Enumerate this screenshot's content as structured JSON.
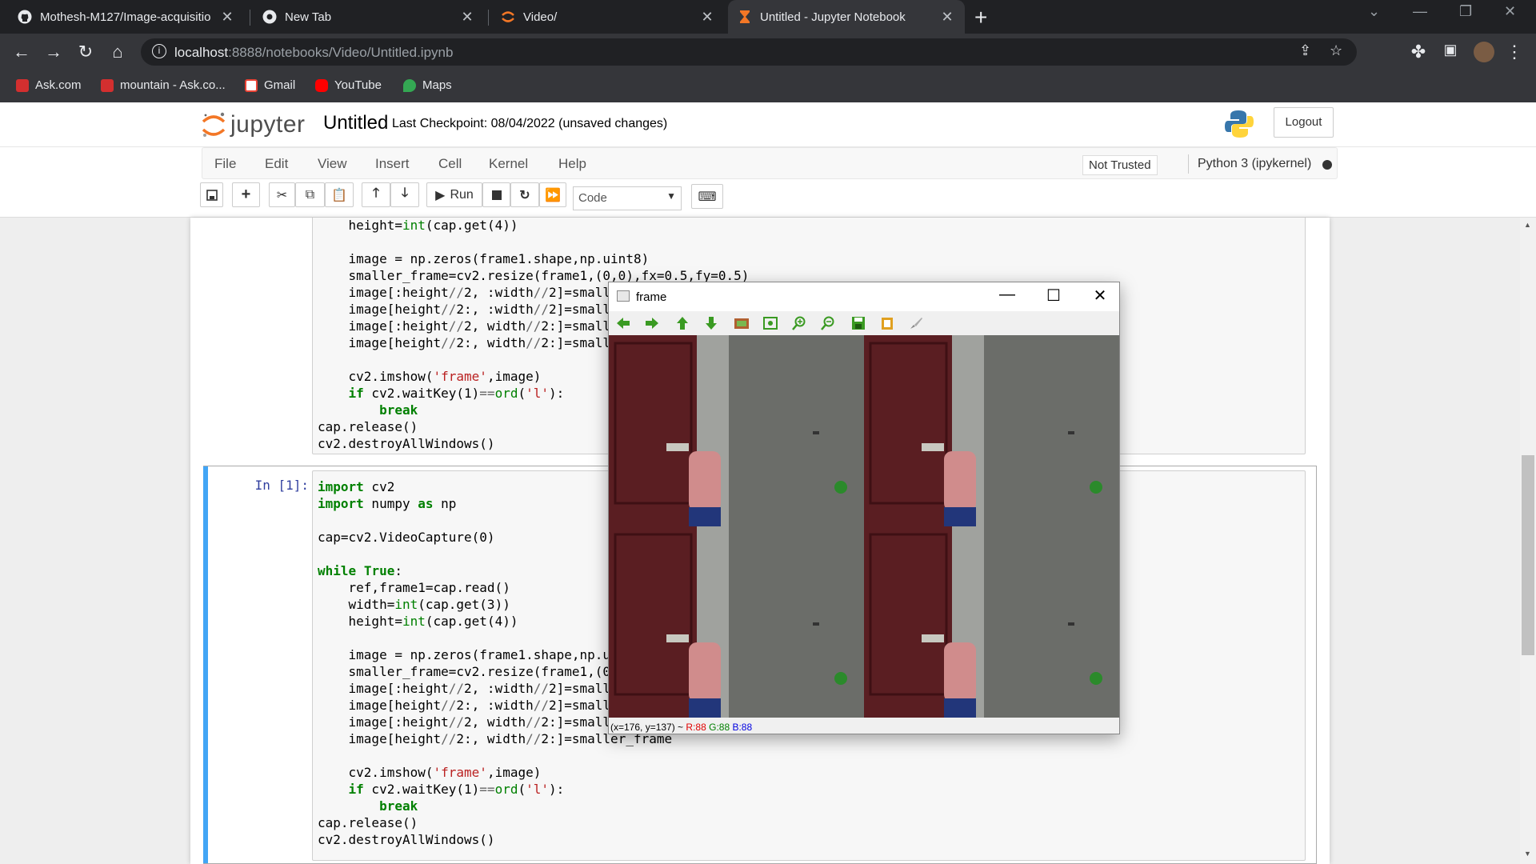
{
  "browser": {
    "tabs": [
      {
        "title": "Mothesh-M127/Image-acquisitio",
        "icon": "github-icon"
      },
      {
        "title": "New Tab",
        "icon": "chrome-icon"
      },
      {
        "title": "Video/",
        "icon": "jupyter-icon"
      },
      {
        "title": "Untitled - Jupyter Notebook",
        "icon": "jupyter-hourglass-icon"
      }
    ],
    "url_host": "localhost",
    "url_path": ":8888/notebooks/Video/Untitled.ipynb",
    "bookmarks": [
      {
        "label": "Ask.com",
        "icon": "ask-icon"
      },
      {
        "label": "mountain - Ask.co...",
        "icon": "ask-icon"
      },
      {
        "label": "Gmail",
        "icon": "gmail-icon"
      },
      {
        "label": "YouTube",
        "icon": "youtube-icon"
      },
      {
        "label": "Maps",
        "icon": "maps-icon"
      }
    ]
  },
  "jupyter": {
    "logo_text": "jupyter",
    "notebook_name": "Untitled",
    "checkpoint": "Last Checkpoint: 08/04/2022  (unsaved changes)",
    "logout": "Logout",
    "menu": [
      "File",
      "Edit",
      "View",
      "Insert",
      "Cell",
      "Kernel",
      "Help"
    ],
    "trust": "Not Trusted",
    "kernel": "Python 3 (ipykernel)",
    "run_label": "Run",
    "cell_type": "Code"
  },
  "cells": [
    {
      "prompt": "",
      "lines": [
        "    height=int(cap.get(4))",
        "",
        "    image = np.zeros(frame1.shape,np.uint8)",
        "    smaller_frame=cv2.resize(frame1,(0,0),fx=0.5,fy=0.5)",
        "    image[:height//2, :width//2]=small",
        "    image[height//2:, :width//2]=small",
        "    image[:height//2, width//2:]=small",
        "    image[height//2:, width//2:]=small",
        "",
        "    cv2.imshow('frame',image)",
        "    if cv2.waitKey(1)==ord('l'):",
        "        break",
        "cap.release()",
        "cv2.destroyAllWindows()"
      ]
    },
    {
      "prompt": "In [1]:",
      "lines": [
        "import cv2",
        "import numpy as np",
        "",
        "cap=cv2.VideoCapture(0)",
        "",
        "while True:",
        "    ref,frame1=cap.read()",
        "    width=int(cap.get(3))",
        "    height=int(cap.get(4))",
        "",
        "    image = np.zeros(frame1.shape,np.u",
        "    smaller_frame=cv2.resize(frame1,(0",
        "    image[:height//2, :width//2]=small",
        "    image[height//2:, :width//2]=small",
        "    image[:height//2, width//2:]=small",
        "    image[height//2:, width//2:]=smaller_frame",
        "",
        "    cv2.imshow('frame',image)",
        "    if cv2.waitKey(1)==ord('l'):",
        "        break",
        "cap.release()",
        "cv2.destroyAllWindows()"
      ]
    }
  ],
  "cv_window": {
    "title": "frame",
    "status_coords": "(x=176, y=137) ~ ",
    "status_r": "R:88",
    "status_g": "G:88",
    "status_b": "B:88",
    "colors": {
      "r": "#e00000",
      "g": "#008000",
      "b": "#0000e0"
    }
  },
  "colors": {
    "accent": "#42a5f5",
    "prompt": "#303f9f",
    "keyword": "#008000",
    "string": "#ba2121"
  }
}
